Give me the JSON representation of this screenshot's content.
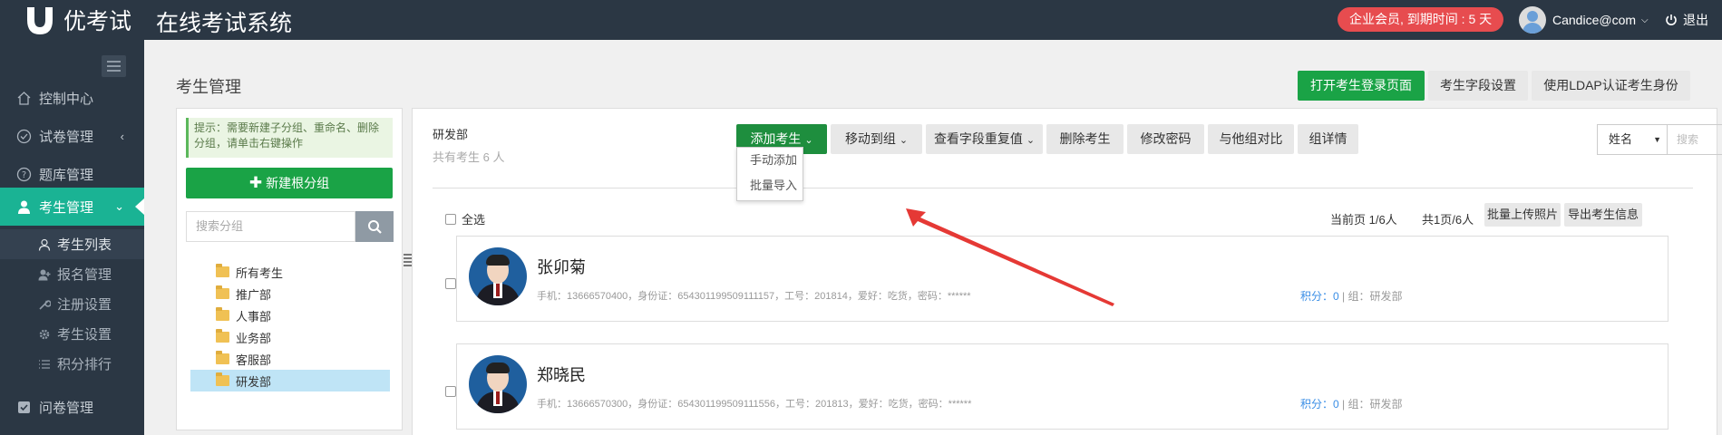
{
  "header": {
    "logo_text": "优考试",
    "app_title": "在线考试系统",
    "vip_badge": "企业会员, 到期时间 : 5 天",
    "user_name": "Candice@com",
    "logout": "退出"
  },
  "sidebar": {
    "items": [
      {
        "label": "控制中心",
        "icon": "home-icon"
      },
      {
        "label": "试卷管理",
        "icon": "check-circle-icon"
      },
      {
        "label": "题库管理",
        "icon": "question-circle-icon"
      },
      {
        "label": "考生管理",
        "icon": "user-icon",
        "active": true
      },
      {
        "label": "问卷管理",
        "icon": "checkbox-icon"
      }
    ],
    "subitems": [
      {
        "label": "考生列表",
        "icon": "user-outline-icon",
        "active": true
      },
      {
        "label": "报名管理",
        "icon": "user-plus-icon"
      },
      {
        "label": "注册设置",
        "icon": "wrench-icon"
      },
      {
        "label": "考生设置",
        "icon": "gear-icon"
      },
      {
        "label": "积分排行",
        "icon": "list-icon"
      }
    ]
  },
  "page": {
    "title": "考生管理",
    "top_buttons": {
      "open_login": "打开考生登录页面",
      "field_settings": "考生字段设置",
      "ldap": "使用LDAP认证考生身份"
    }
  },
  "groups": {
    "hint": "提示：需要新建子分组、重命名、删除分组，请单击右键操作",
    "new_root": "新建根分组",
    "search_placeholder": "搜索分组",
    "tree": [
      "所有考生",
      "推广部",
      "人事部",
      "业务部",
      "客服部",
      "研发部"
    ],
    "selected": "研发部"
  },
  "main": {
    "dept_name": "研发部",
    "dept_count": "共有考生 6 人",
    "toolbar": {
      "add": "添加考生",
      "move": "移动到组",
      "dup": "查看字段重复值",
      "delete": "删除考生",
      "password": "修改密码",
      "compare": "与他组对比",
      "detail": "组详情",
      "select_value": "姓名",
      "search_placeholder": "搜索"
    },
    "dropdown": [
      "手动添加",
      "批量导入"
    ],
    "check_all": "全选",
    "page_current": "当前页 1/6人",
    "page_total": "共1页/6人",
    "batch_photo": "批量上传照片",
    "export": "导出考生信息"
  },
  "students": [
    {
      "name": "张卯菊",
      "meta": "手机：13666570400，身份证：654301199509111157，工号：201814，爱好：吃货，密码：******",
      "score_label": "积分：",
      "score": "0",
      "group_label": "组：研发部"
    },
    {
      "name": "郑晓民",
      "meta": "手机：13666570300，身份证：654301199509111556，工号：201813，爱好：吃货，密码：******",
      "score_label": "积分：",
      "score": "0",
      "group_label": "组：研发部"
    }
  ],
  "colors": {
    "topbar": "#2b3744",
    "accent_green": "#1aa346",
    "active_teal": "#1ab394",
    "badge_red": "#e74c4f",
    "annotation_red": "#e53935"
  }
}
